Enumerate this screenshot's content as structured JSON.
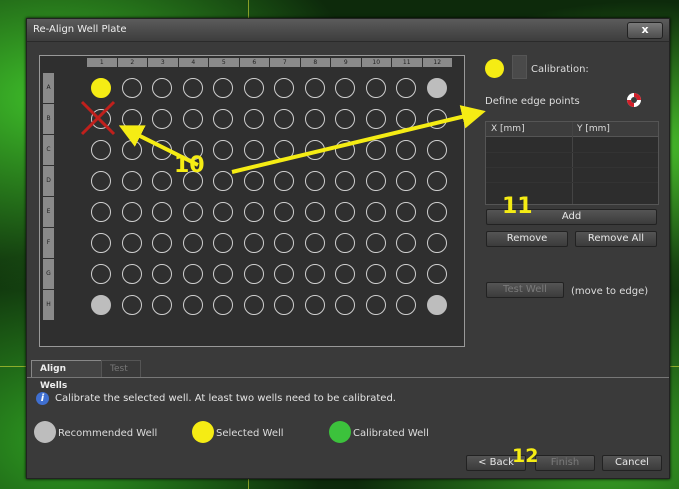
{
  "window": {
    "title": "Re-Align Well Plate",
    "close_label": "x"
  },
  "plate": {
    "columns": [
      "1",
      "2",
      "3",
      "4",
      "5",
      "6",
      "7",
      "8",
      "9",
      "10",
      "11",
      "12"
    ],
    "rows": [
      "A",
      "B",
      "C",
      "D",
      "E",
      "F",
      "G",
      "H"
    ],
    "recommended_wells": [
      "A12",
      "H1",
      "H12"
    ],
    "selected_wells": [
      "A1"
    ],
    "crossed_wells": [
      "A1"
    ]
  },
  "calibration": {
    "label": "Calibration:",
    "dot_color": "#f5ec14"
  },
  "edge_points": {
    "label": "Define edge points",
    "columns": [
      "X [mm]",
      "Y [mm]"
    ],
    "add_label": "Add",
    "remove_label": "Remove",
    "remove_all_label": "Remove All",
    "test_well_label": "Test Well",
    "move_label": "(move to edge)"
  },
  "tabs": [
    {
      "label": "Align Wells",
      "active": true
    },
    {
      "label": "Test",
      "active": false
    }
  ],
  "info": {
    "icon": "info-icon",
    "text": "Calibrate the selected well. At least two wells need to be calibrated."
  },
  "legend": [
    {
      "label": "Recommended Well",
      "color": "#bdbdbd"
    },
    {
      "label": "Selected Well",
      "color": "#f5ec14"
    },
    {
      "label": "Calibrated Well",
      "color": "#3cc23c"
    }
  ],
  "footer": {
    "back_label": "< Back",
    "finish_label": "Finish",
    "cancel_label": "Cancel"
  },
  "annotations": [
    "10",
    "11",
    "12"
  ],
  "colors": {
    "accent": "#f5ec14",
    "window_bg": "#3a3a3a"
  }
}
